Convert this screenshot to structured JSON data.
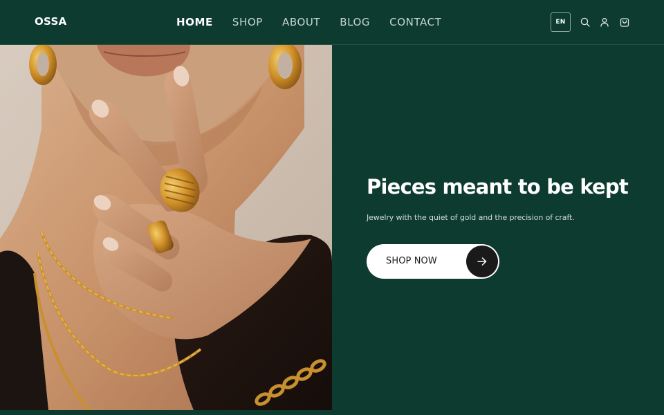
{
  "brand": {
    "logo": "OSSA"
  },
  "nav": {
    "items": [
      {
        "label": "HOME",
        "active": true
      },
      {
        "label": "SHOP",
        "active": false
      },
      {
        "label": "ABOUT",
        "active": false
      },
      {
        "label": "BLOG",
        "active": false
      },
      {
        "label": "CONTACT",
        "active": false
      }
    ]
  },
  "header": {
    "language": "EN",
    "icons": [
      "search-icon",
      "user-icon",
      "cart-icon"
    ]
  },
  "hero": {
    "image": "jewelry-model-photo",
    "title": "Pieces meant to be kept",
    "subtitle": "Jewelry with the quiet of gold and the precision of craft.",
    "cta_label": "SHOP NOW",
    "cta_icon": "arrow-right-icon"
  },
  "colors": {
    "background": "#0d3b2f",
    "text": "#ffffff",
    "button_bg": "#ffffff",
    "button_arrow_bg": "#1a1a1a",
    "gold": "#c8902e"
  }
}
